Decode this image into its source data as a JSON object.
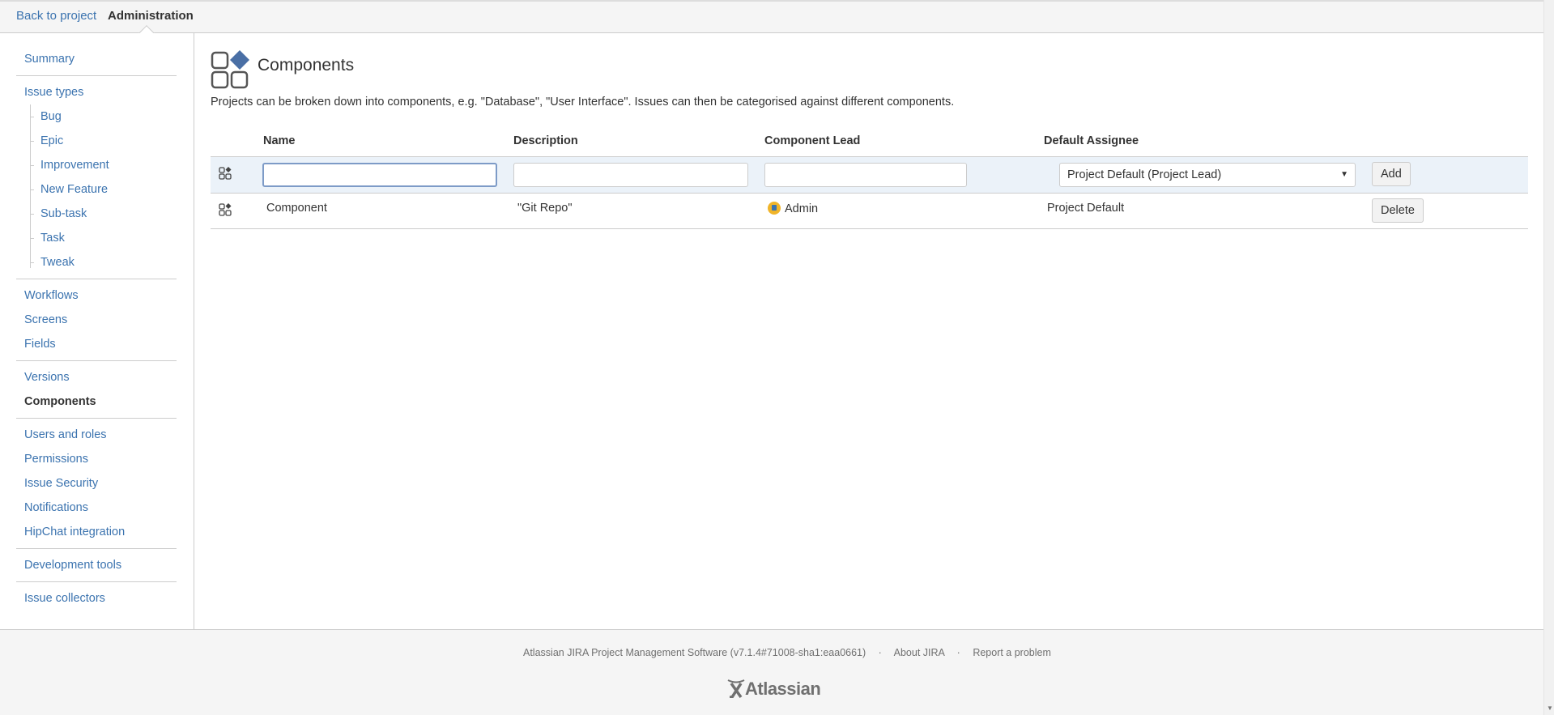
{
  "header": {
    "back_label": "Back to project",
    "admin_label": "Administration"
  },
  "sidebar": {
    "summary": "Summary",
    "issue_types": "Issue types",
    "issue_type_items": [
      "Bug",
      "Epic",
      "Improvement",
      "New Feature",
      "Sub-task",
      "Task",
      "Tweak"
    ],
    "workflows": "Workflows",
    "screens": "Screens",
    "fields": "Fields",
    "versions": "Versions",
    "components": "Components",
    "users_roles": "Users and roles",
    "permissions": "Permissions",
    "issue_security": "Issue Security",
    "notifications": "Notifications",
    "hipchat": "HipChat integration",
    "dev_tools": "Development tools",
    "issue_collectors": "Issue collectors",
    "active": "Components"
  },
  "page": {
    "title": "Components",
    "icon": "components-icon",
    "description": "Projects can be broken down into components, e.g. \"Database\", \"User Interface\". Issues can then be categorised against different components."
  },
  "table": {
    "headers": {
      "name": "Name",
      "description": "Description",
      "lead": "Component Lead",
      "assignee": "Default Assignee"
    },
    "add_row": {
      "name_value": "",
      "description_value": "",
      "lead_value": "",
      "assignee_selected": "Project Default (Project Lead)",
      "add_label": "Add"
    },
    "rows": [
      {
        "name": "Component",
        "description": "\"Git Repo\"",
        "lead": "Admin",
        "assignee": "Project Default",
        "delete_label": "Delete"
      }
    ]
  },
  "footer": {
    "software": "Atlassian JIRA Project Management Software (v7.1.4#71008-sha1:eaa0661)",
    "separator": "·",
    "about": "About JIRA",
    "report": "Report a problem",
    "logo": "Atlassian"
  },
  "colors": {
    "link": "#3b73af",
    "add_row_bg": "#ebf2f9",
    "icon_accent": "#4a6fa5"
  }
}
